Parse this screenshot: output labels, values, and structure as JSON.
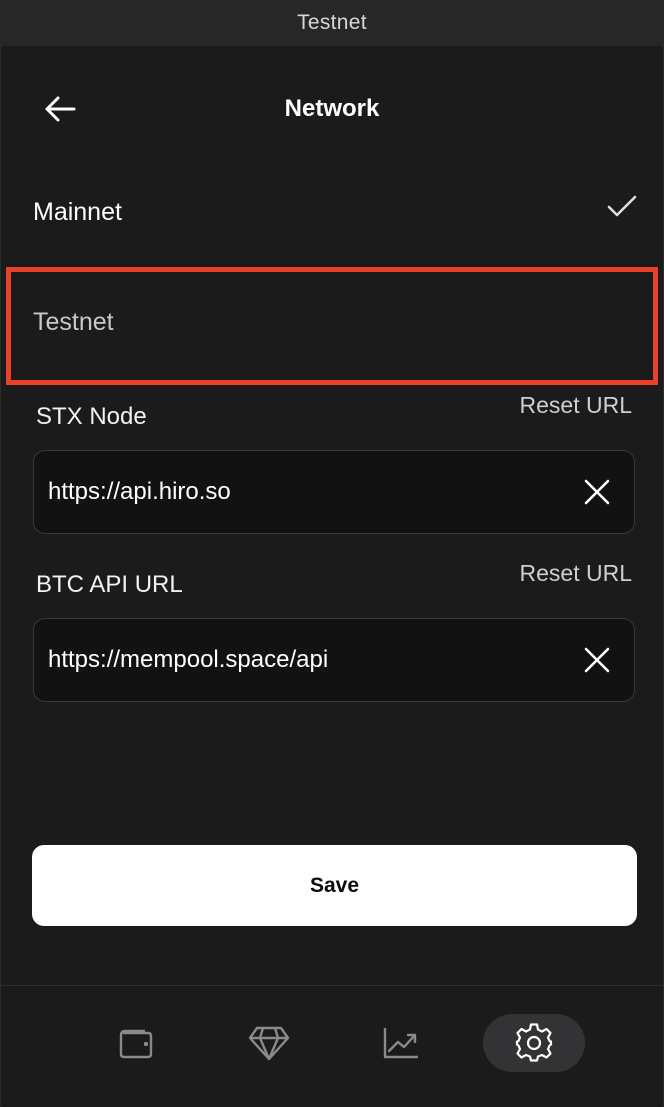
{
  "banner": {
    "network_label": "Testnet"
  },
  "header": {
    "title": "Network",
    "back_icon": "arrow-left-icon"
  },
  "networks": [
    {
      "label": "Mainnet",
      "selected": true
    },
    {
      "label": "Testnet",
      "selected": false,
      "highlighted": true
    }
  ],
  "stx_node": {
    "label": "STX Node",
    "reset_label": "Reset URL",
    "value": "https://api.hiro.so"
  },
  "btc_api": {
    "label": "BTC API URL",
    "reset_label": "Reset URL",
    "value": "https://mempool.space/api"
  },
  "save_label": "Save",
  "nav": [
    {
      "name": "wallet",
      "icon": "wallet-icon",
      "active": false
    },
    {
      "name": "collectibles",
      "icon": "diamond-icon",
      "active": false
    },
    {
      "name": "stacking",
      "icon": "chart-icon",
      "active": false
    },
    {
      "name": "settings",
      "icon": "gear-icon",
      "active": true
    }
  ],
  "colors": {
    "background": "#1b1b1c",
    "highlight_border": "#e8402a",
    "save_button": "#ffffff",
    "active_nav": "#333335"
  }
}
